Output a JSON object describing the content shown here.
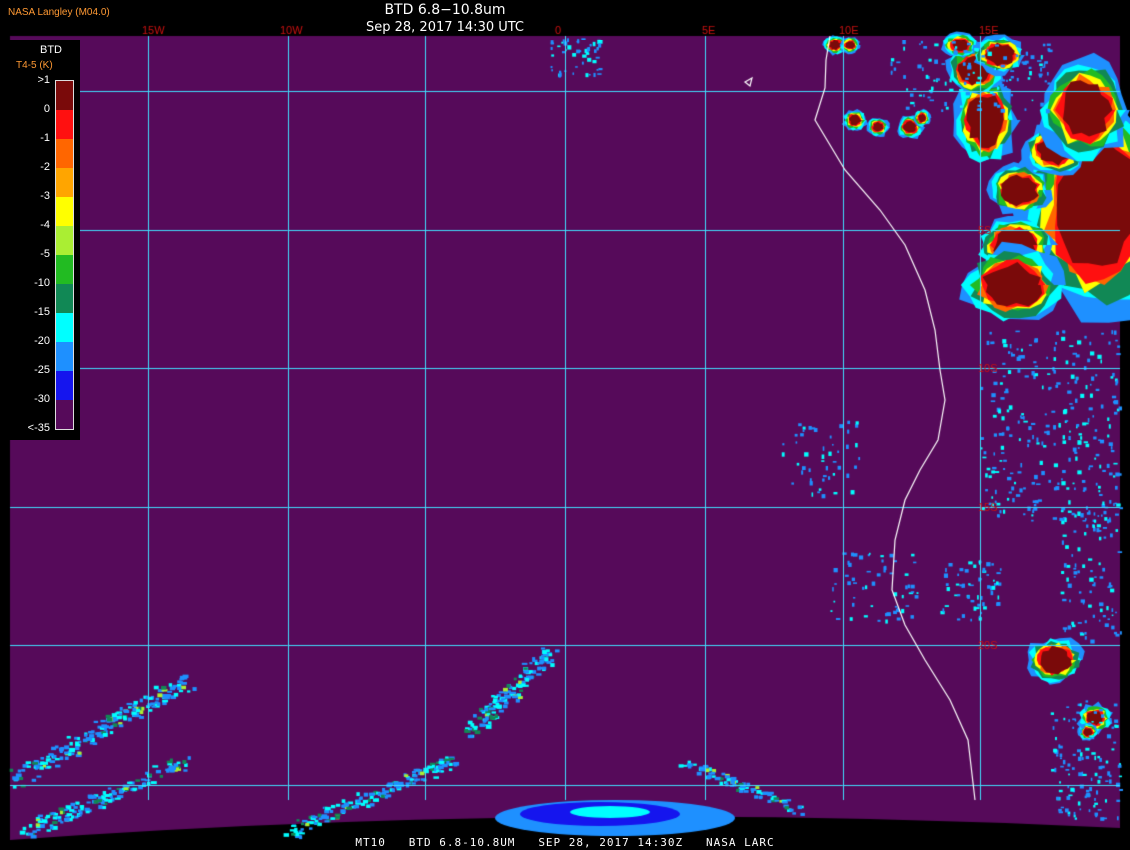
{
  "header": {
    "credit": "NASA Langley (M04.0)",
    "title": "BTD 6.8−10.8um",
    "timestamp": "Sep 28, 2017 14:30 UTC"
  },
  "footer": {
    "satellite": "MT10",
    "product": "BTD 6.8-10.8UM",
    "datetime": "SEP 28, 2017 14:30Z",
    "source": "NASA LARC"
  },
  "legend": {
    "title": "BTD",
    "subtitle": "T4-5 (K)",
    "labels": [
      ">1",
      "0",
      "-1",
      "-2",
      "-3",
      "-4",
      "-5",
      "-10",
      "-15",
      "-20",
      "-25",
      "-30",
      "<-35"
    ],
    "colors": [
      "#7a0a0a",
      "#ff1010",
      "#ff6600",
      "#ffa500",
      "#ffff00",
      "#aaee33",
      "#22bb22",
      "#118855",
      "#00ffff",
      "#1e90ff",
      "#1515ee",
      "#560a5a"
    ]
  },
  "map": {
    "background_color": "#560a5a",
    "grid_color": "#40e0ff",
    "coastline_color": "#ffffff",
    "label_color": "#cc1111",
    "lon_labels": [
      "15W",
      "10W",
      "0",
      "5E",
      "10E",
      "15E"
    ],
    "lat_labels": [
      "5S",
      "10S",
      "15S",
      "20S"
    ]
  }
}
